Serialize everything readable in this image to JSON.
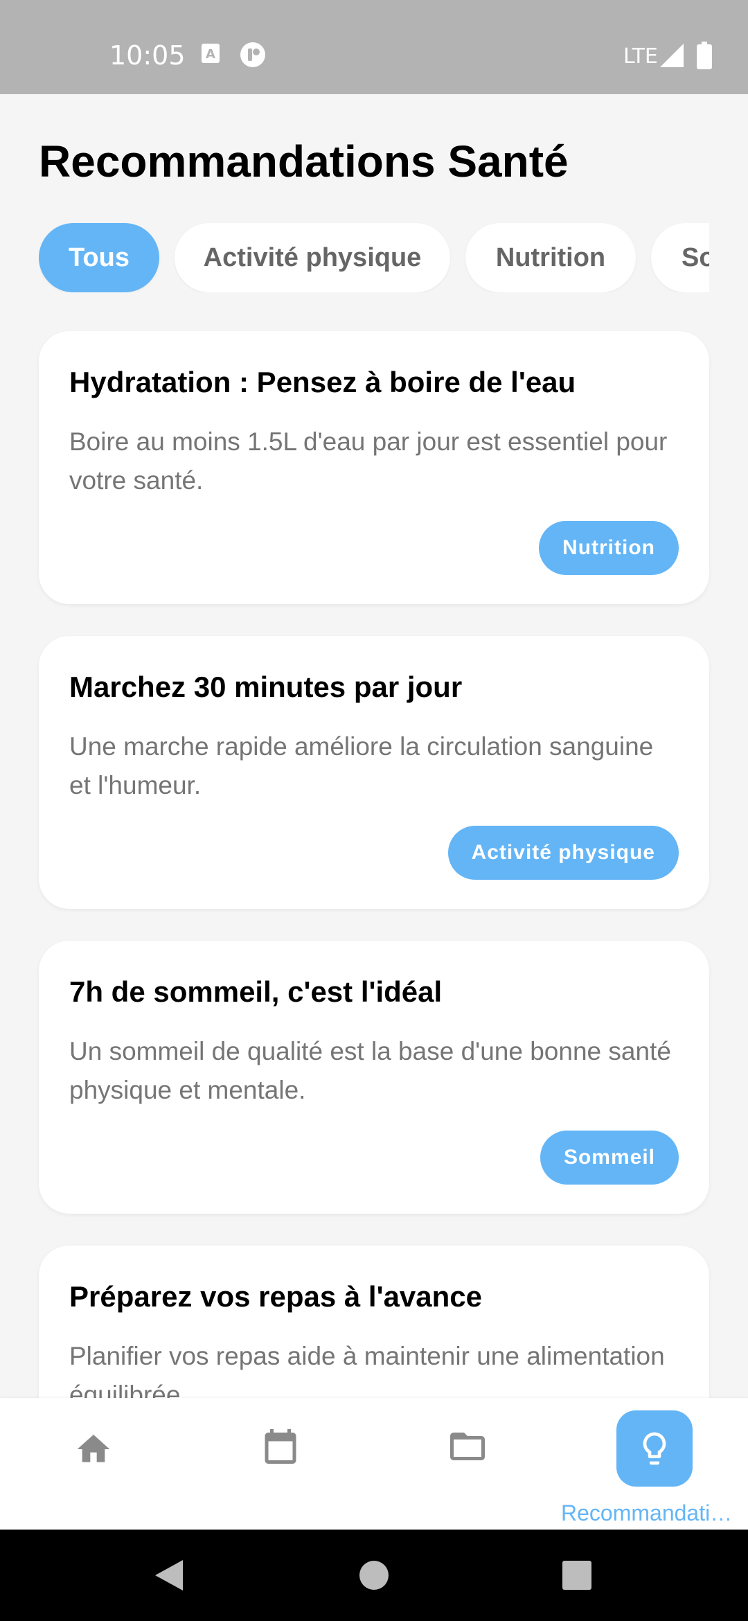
{
  "status_bar": {
    "time": "10:05",
    "network": "LTE",
    "icons": [
      "keyboard-a-icon",
      "app-badge-icon",
      "signal-icon",
      "battery-icon"
    ]
  },
  "page_title": "Recommandations Santé",
  "filters": [
    {
      "label": "Tous",
      "selected": true
    },
    {
      "label": "Activité physique",
      "selected": false
    },
    {
      "label": "Nutrition",
      "selected": false
    },
    {
      "label": "So",
      "selected": false
    }
  ],
  "recommendations": [
    {
      "title": "Hydratation : Pensez à boire de l'eau",
      "description": "Boire au moins 1.5L d'eau par jour est essentiel pour votre santé.",
      "tag": "Nutrition"
    },
    {
      "title": "Marchez 30 minutes par jour",
      "description": "Une marche rapide améliore la circulation sanguine et l'humeur.",
      "tag": "Activité physique"
    },
    {
      "title": "7h de sommeil, c'est l'idéal",
      "description": "Un sommeil de qualité est la base d'une bonne santé physique et mentale.",
      "tag": "Sommeil"
    },
    {
      "title": "Préparez vos repas à l'avance",
      "description": "Planifier vos repas aide à maintenir une alimentation équilibrée."
    }
  ],
  "bottom_nav": {
    "items": [
      {
        "icon": "home-icon"
      },
      {
        "icon": "calendar-icon"
      },
      {
        "icon": "folder-icon"
      },
      {
        "icon": "lightbulb-icon",
        "label": "Recommandati…",
        "active": true
      }
    ]
  },
  "colors": {
    "accent": "#64b5f6",
    "background": "#f5f5f5",
    "card": "#ffffff",
    "text_primary": "#000000",
    "text_secondary": "#757575"
  }
}
